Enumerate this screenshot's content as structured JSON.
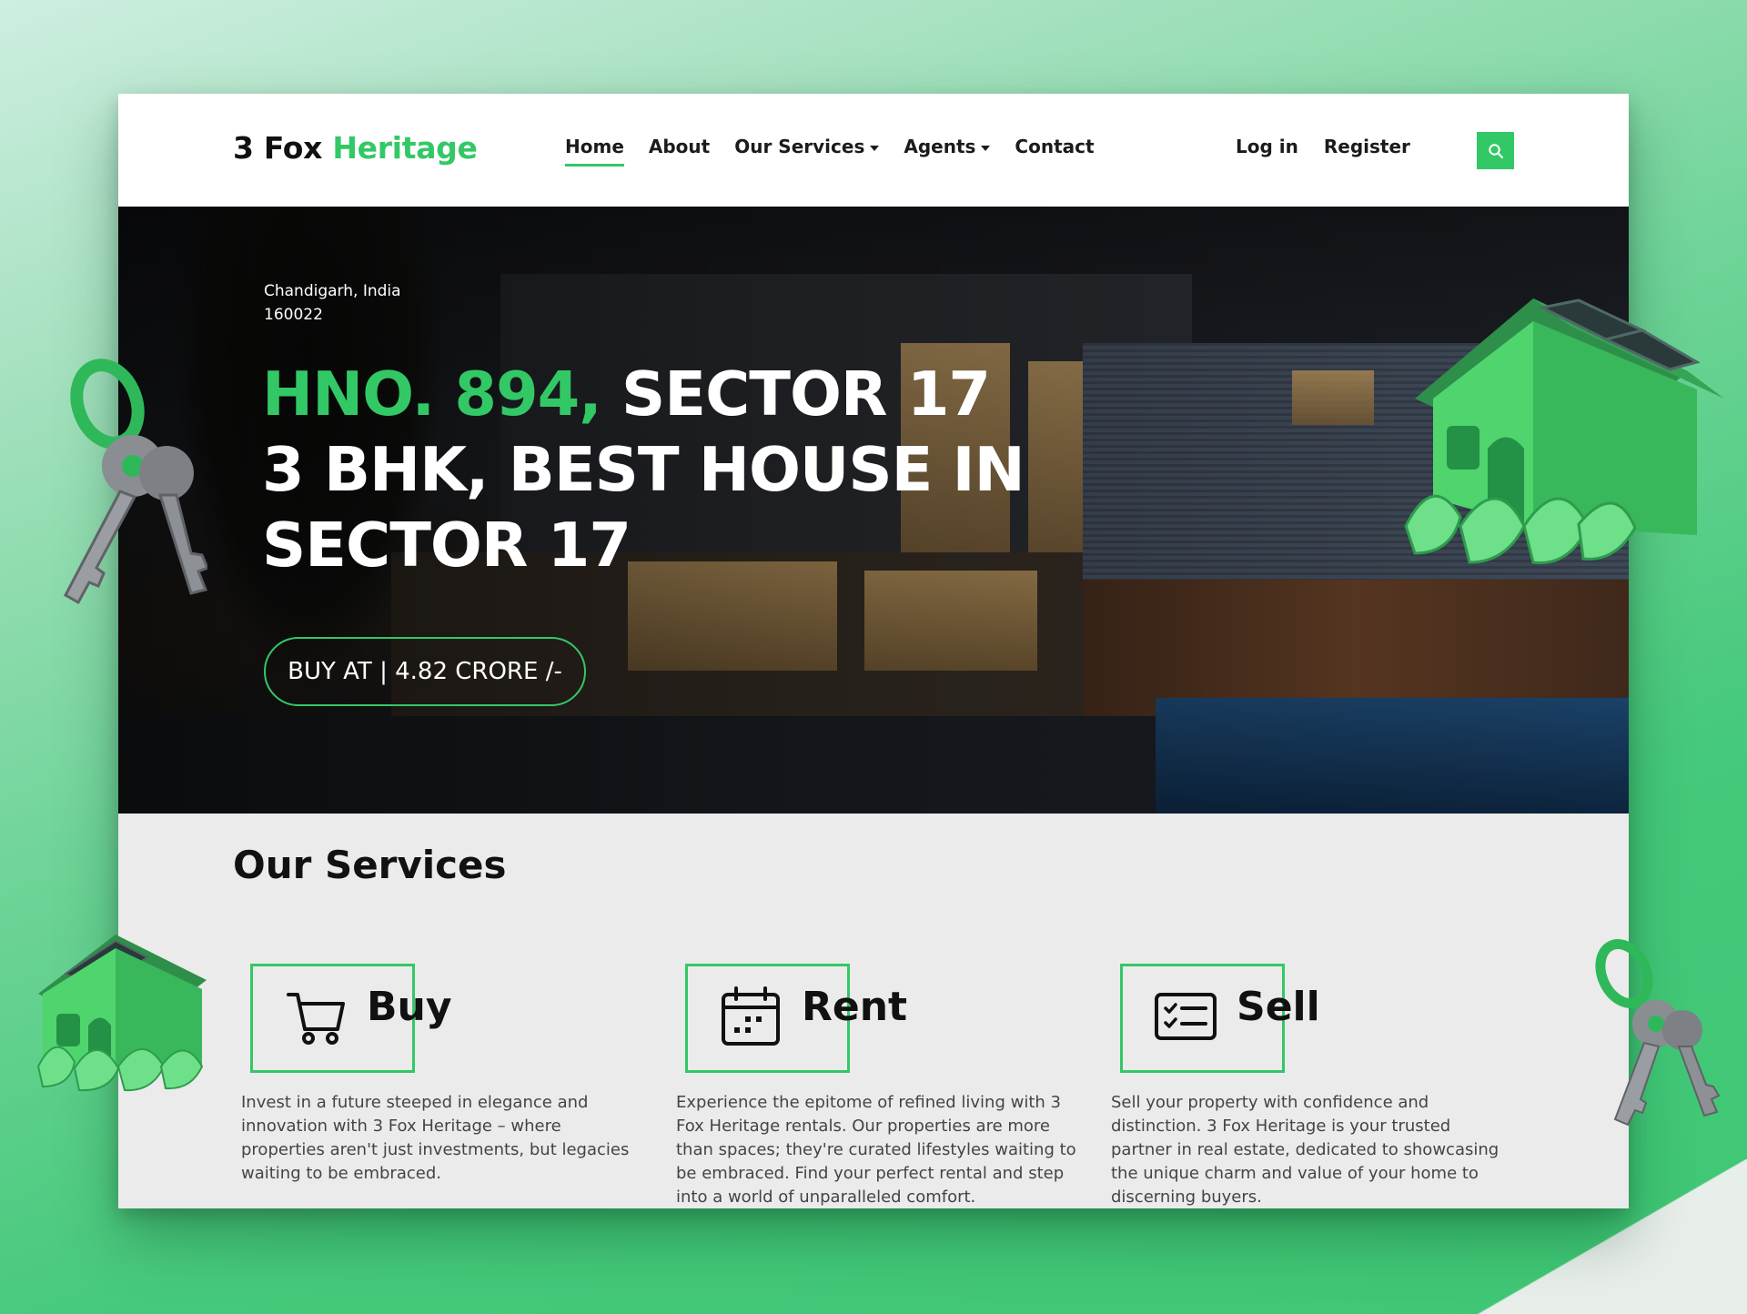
{
  "brand": {
    "part1": "3 Fox",
    "part2": "Heritage"
  },
  "nav": {
    "items": [
      {
        "label": "Home"
      },
      {
        "label": "About"
      },
      {
        "label": "Our Services"
      },
      {
        "label": "Agents"
      },
      {
        "label": "Contact"
      }
    ],
    "login": "Log in",
    "register": "Register"
  },
  "hero": {
    "location_line1": "Chandigarh, India",
    "location_line2": "160022",
    "headline_accent": "HNO. 894,",
    "headline_rest": " SECTOR 17",
    "headline_line2": "3 BHK, BEST HOUSE IN",
    "headline_line3": "SECTOR 17",
    "cta": "BUY AT | 4.82 CRORE /-"
  },
  "services": {
    "title": "Our Services",
    "items": [
      {
        "label": "Buy",
        "icon": "cart-icon",
        "desc": "Invest in a future steeped in elegance and innovation with 3 Fox Heritage – where properties aren't just investments, but legacies waiting to be embraced."
      },
      {
        "label": "Rent",
        "icon": "calendar-icon",
        "desc": "Experience the epitome of refined living with 3 Fox Heritage rentals. Our properties are more than spaces; they're curated lifestyles waiting to be embraced. Find your perfect rental and step into a world of unparalleled comfort."
      },
      {
        "label": "Sell",
        "icon": "checklist-icon",
        "desc": "Sell your property with confidence and distinction. 3 Fox Heritage is your trusted partner in real estate, dedicated to showcasing the unique charm and value of your home to discerning buyers."
      }
    ]
  },
  "colors": {
    "accent": "#33c866",
    "text": "#111111",
    "background": "#ebebeb"
  }
}
